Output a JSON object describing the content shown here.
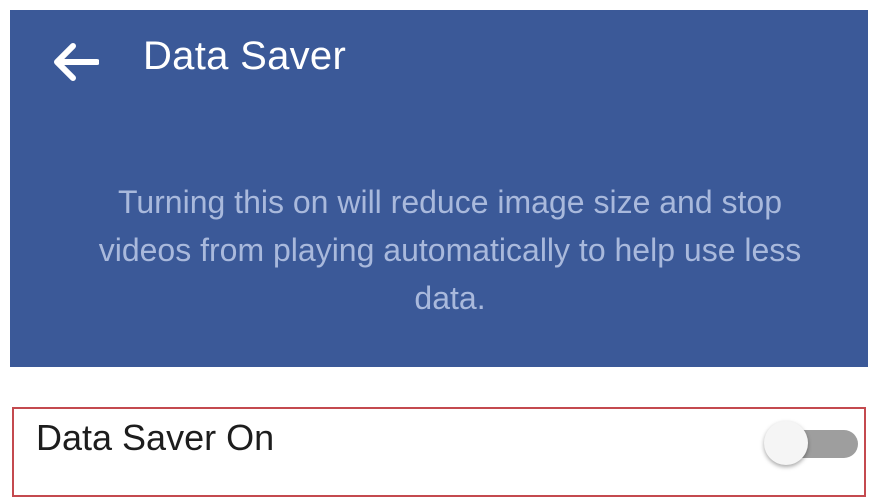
{
  "header": {
    "title": "Data Saver",
    "back_icon": "arrow-left-icon",
    "background_color": "#3b5998",
    "description": "Turning this on will reduce image size and stop videos from playing automatically to help use less data."
  },
  "setting": {
    "label": "Data Saver On",
    "toggle_state": "off",
    "highlight_color": "#c44a4f"
  }
}
